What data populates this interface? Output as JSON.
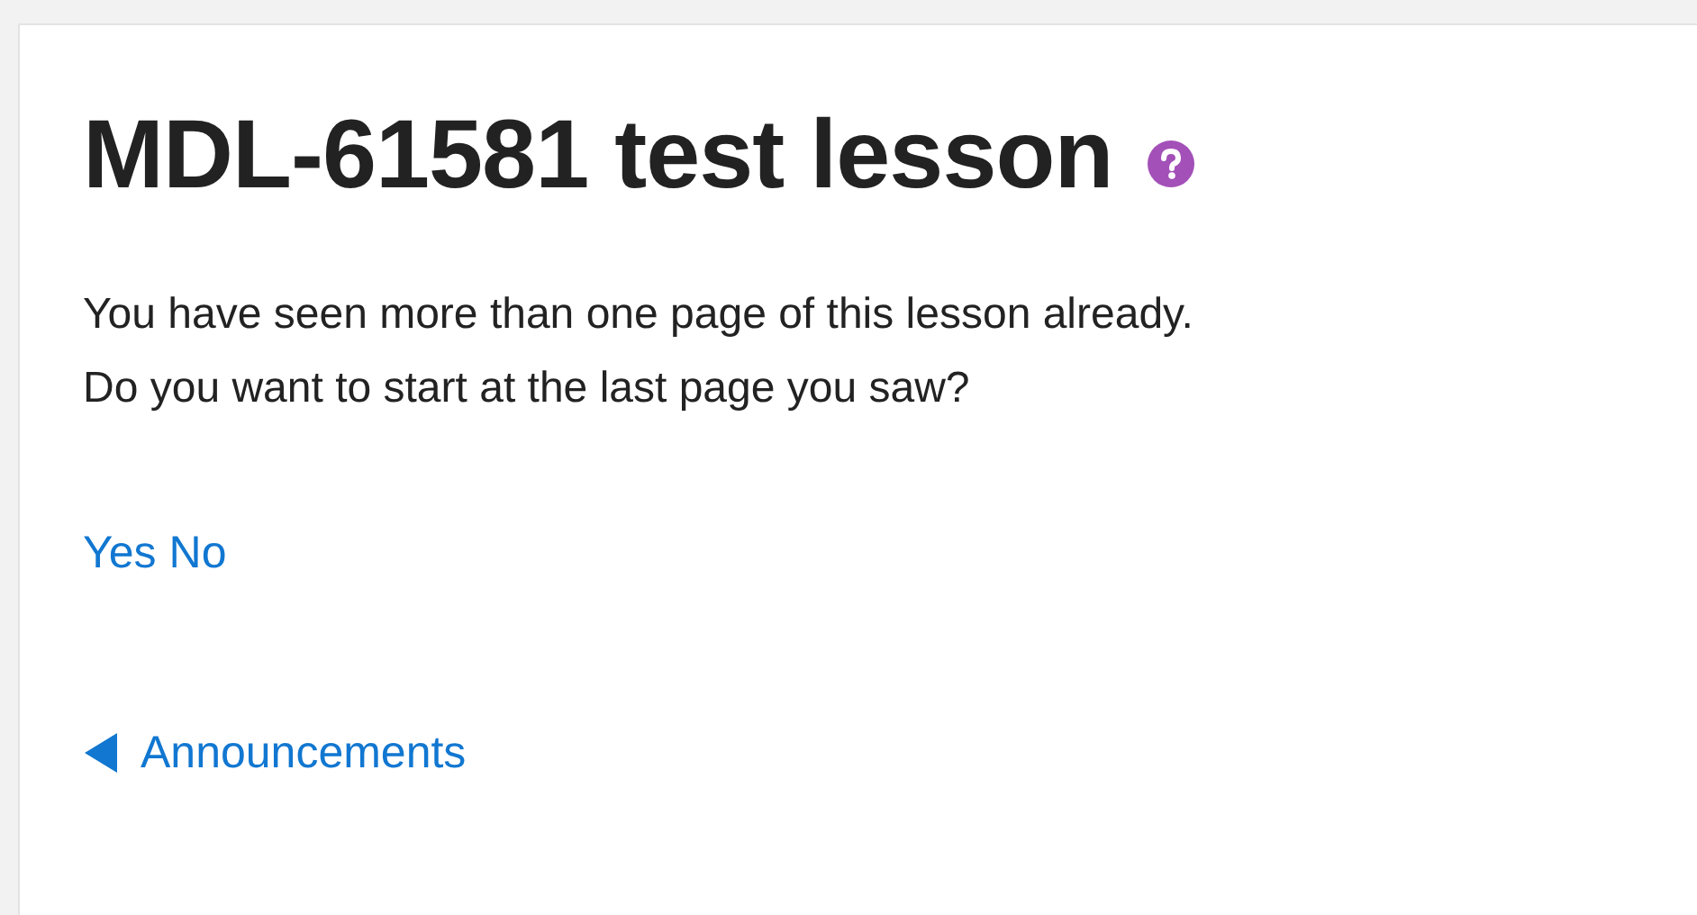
{
  "heading": {
    "title": "MDL-61581 test lesson"
  },
  "message": [
    "You have seen more than one page of this lesson already.",
    "Do you want to start at the last page you saw?"
  ],
  "choices": [
    {
      "label": "Yes"
    },
    {
      "label": "No"
    }
  ],
  "previous_link": {
    "label": "Announcements"
  }
}
